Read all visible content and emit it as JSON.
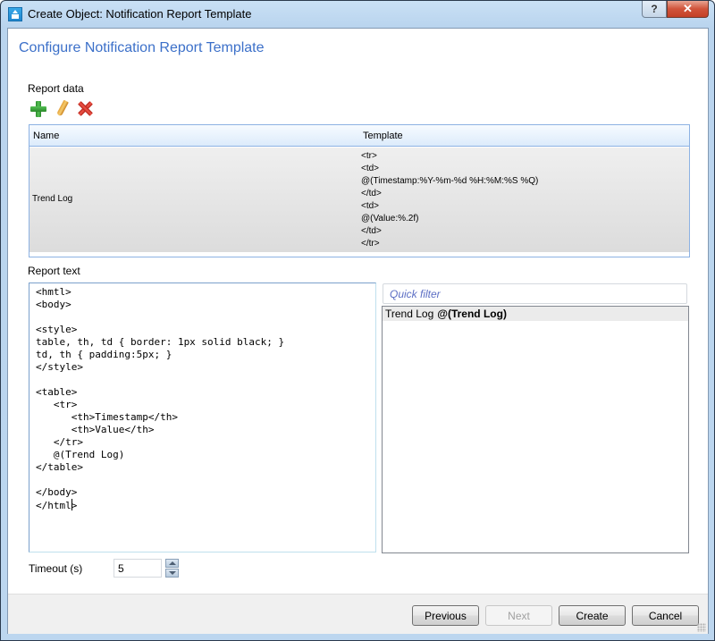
{
  "window": {
    "title": "Create Object: Notification Report Template",
    "help_label": "?",
    "close_label": "✕"
  },
  "page": {
    "title": "Configure Notification Report Template"
  },
  "report_data": {
    "label": "Report data",
    "toolbar": {
      "icons": [
        "add-icon",
        "edit-icon",
        "delete-icon"
      ]
    },
    "columns": [
      "Name",
      "Template"
    ],
    "rows": [
      {
        "name": "Trend Log",
        "template_lines": [
          "<tr>",
          "<td>",
          "@(Timestamp:%Y-%m-%d %H:%M:%S %Q)",
          "</td>",
          "<td>",
          "@(Value:%.2f)",
          "</td>",
          "</tr>"
        ]
      }
    ]
  },
  "report_text": {
    "label": "Report text",
    "content_before_cursor": "<hmtl>\n<body>\n\n<style>\ntable, th, td { border: 1px solid black; }\ntd, th { padding:5px; }\n</style>\n\n<table>\n   <tr>\n      <th>Timestamp</th>\n      <th>Value</th>\n   </tr>\n   @(Trend Log)\n</table>\n\n</body>\n</html",
    "content_after_cursor": ">"
  },
  "quick_filter": {
    "placeholder": "Quick filter",
    "value": ""
  },
  "variables": [
    {
      "name": "Trend Log",
      "token": "@(Trend Log)"
    }
  ],
  "timeout": {
    "label": "Timeout (s)",
    "value": "5"
  },
  "footer": {
    "previous_label": "Previous",
    "next_label": "Next",
    "create_label": "Create",
    "cancel_label": "Cancel"
  },
  "colors": {
    "accent_title": "#3c70c9",
    "placeholder": "#5c6ec4",
    "close_button": "#c44027"
  }
}
